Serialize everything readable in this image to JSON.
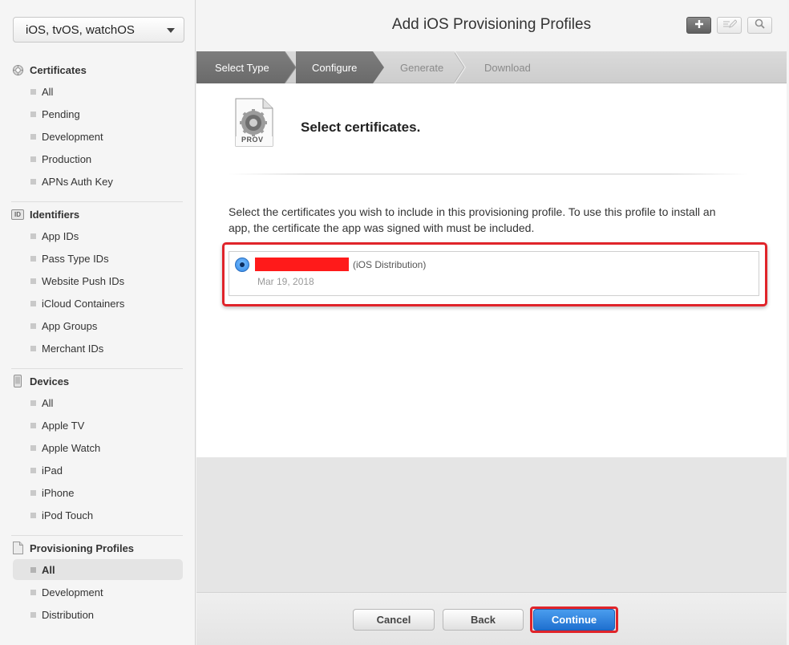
{
  "sidebar": {
    "platform": "iOS, tvOS, watchOS",
    "sections": [
      {
        "title": "Certificates",
        "icon": "gear-certificate-icon",
        "items": [
          "All",
          "Pending",
          "Development",
          "Production",
          "APNs Auth Key"
        ]
      },
      {
        "title": "Identifiers",
        "icon": "id-badge-icon",
        "icon_text": "ID",
        "items": [
          "App IDs",
          "Pass Type IDs",
          "Website Push IDs",
          "iCloud Containers",
          "App Groups",
          "Merchant IDs"
        ]
      },
      {
        "title": "Devices",
        "icon": "device-phone-icon",
        "items": [
          "All",
          "Apple TV",
          "Apple Watch",
          "iPad",
          "iPhone",
          "iPod Touch"
        ]
      },
      {
        "title": "Provisioning Profiles",
        "icon": "document-icon",
        "items": [
          "All",
          "Development",
          "Distribution"
        ],
        "active_item": "All"
      }
    ]
  },
  "header": {
    "title": "Add iOS Provisioning Profiles",
    "tools": [
      "plus-icon",
      "edit-icon",
      "search-icon"
    ]
  },
  "steps": [
    {
      "label": "Select Type",
      "state": "done"
    },
    {
      "label": "Configure",
      "state": "done"
    },
    {
      "label": "Generate",
      "state": "todo"
    },
    {
      "label": "Download",
      "state": "todo"
    }
  ],
  "content": {
    "icon_label": "PROV",
    "heading": "Select certificates.",
    "instructions": "Select the certificates you wish to include in this provisioning profile. To use this profile to install an app, the certificate the app was signed with must be included.",
    "certificate": {
      "type": "(iOS Distribution)",
      "date": "Mar 19, 2018",
      "selected": true,
      "highlight_color": "#e0242a",
      "redaction_color": "#ff1a1a"
    }
  },
  "footer": {
    "cancel": "Cancel",
    "back": "Back",
    "continue": "Continue"
  },
  "colors": {
    "primary_button": "#1f6fcf",
    "highlight": "#e0242a"
  }
}
